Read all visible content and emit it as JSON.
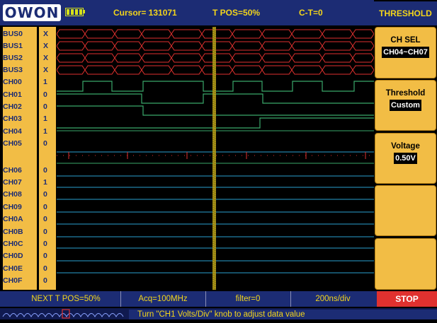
{
  "header": {
    "logo": "OWON",
    "cursor": "Cursor= 131071",
    "tpos": "T POS=50%",
    "ct": "C-T=0"
  },
  "menu": {
    "title": "THRESHOLD",
    "ch_sel": {
      "label": "CH SEL",
      "value": "CH04~CH07"
    },
    "threshold": {
      "label": "Threshold",
      "value": "Custom"
    },
    "voltage": {
      "label": "Voltage",
      "value": "0.50V"
    }
  },
  "channels": [
    {
      "name": "BUS0",
      "value": "X"
    },
    {
      "name": "BUS1",
      "value": "X"
    },
    {
      "name": "BUS2",
      "value": "X"
    },
    {
      "name": "BUS3",
      "value": "X"
    },
    {
      "name": "CH00",
      "value": "1"
    },
    {
      "name": "CH01",
      "value": "0"
    },
    {
      "name": "CH02",
      "value": "0"
    },
    {
      "name": "CH03",
      "value": "1"
    },
    {
      "name": "CH04",
      "value": "1"
    },
    {
      "name": "CH05",
      "value": "0"
    },
    {
      "name": "CH06",
      "value": "0"
    },
    {
      "name": "CH07",
      "value": "1"
    },
    {
      "name": "CH08",
      "value": "0"
    },
    {
      "name": "CH09",
      "value": "0"
    },
    {
      "name": "CH0A",
      "value": "0"
    },
    {
      "name": "CH0B",
      "value": "0"
    },
    {
      "name": "CH0C",
      "value": "0"
    },
    {
      "name": "CH0D",
      "value": "0"
    },
    {
      "name": "CH0E",
      "value": "0"
    },
    {
      "name": "CH0F",
      "value": "0"
    }
  ],
  "footer": {
    "tpos": "NEXT T POS=50%",
    "acq": "Acq=100MHz",
    "filter": "filter=0",
    "timebase": "200ns/div",
    "stop": "STOP",
    "hint": "Turn \"CH1 Volts/Div\" knob to adjust data value"
  },
  "colors": {
    "accent": "#f2bd45",
    "navy": "#1c2c74",
    "bus": "#e0312f",
    "signal_high": "#3aa86a",
    "signal_low": "#2aa0d0",
    "trigger": "#b9a21a"
  }
}
